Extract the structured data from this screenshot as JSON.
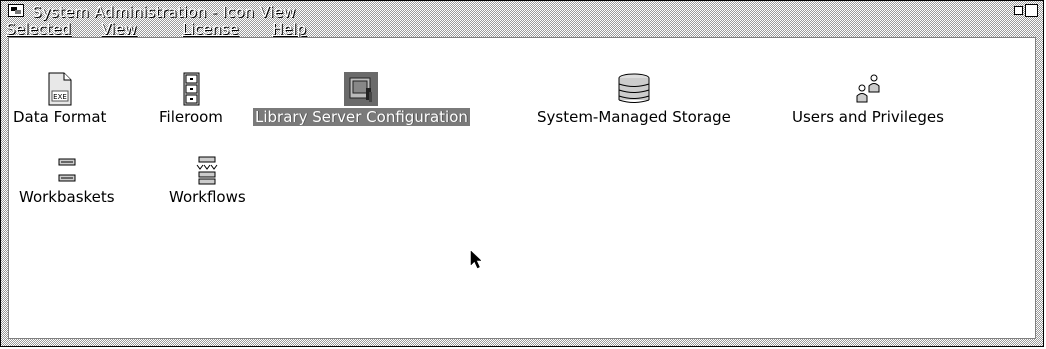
{
  "window": {
    "title": "System Administration - Icon View"
  },
  "menubar": {
    "items": [
      {
        "label": "Selected"
      },
      {
        "label": "View"
      },
      {
        "label": "License"
      },
      {
        "label": "Help"
      }
    ]
  },
  "icons": [
    {
      "label": "Data Format",
      "icon": "document-exe-icon",
      "selected": false
    },
    {
      "label": "Fileroom",
      "icon": "file-cabinet-icon",
      "selected": false
    },
    {
      "label": "Library Server Configuration",
      "icon": "server-config-icon",
      "selected": true
    },
    {
      "label": "System-Managed Storage",
      "icon": "disk-stack-icon",
      "selected": false
    },
    {
      "label": "Users and Privileges",
      "icon": "users-icon",
      "selected": false
    },
    {
      "label": "Workbaskets",
      "icon": "workbasket-icon",
      "selected": false
    },
    {
      "label": "Workflows",
      "icon": "workflow-icon",
      "selected": false
    }
  ],
  "data_format_icon_text": "EXE"
}
